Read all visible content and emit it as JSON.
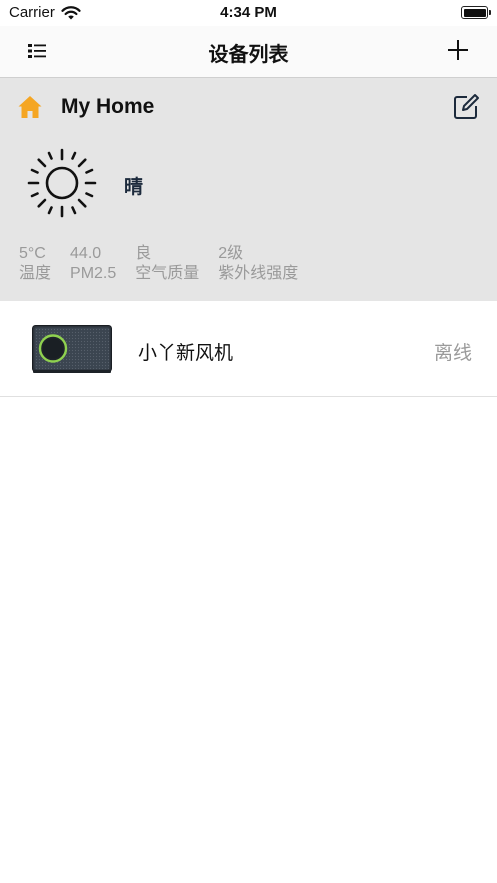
{
  "status_bar": {
    "carrier": "Carrier",
    "time": "4:34 PM"
  },
  "nav": {
    "title": "设备列表",
    "menu_icon": "list-icon",
    "add_icon": "plus-icon"
  },
  "home": {
    "name": "My Home",
    "icon": "home-icon",
    "accent_color": "#f5a623",
    "edit_icon": "edit-icon"
  },
  "weather": {
    "icon": "sun-icon",
    "description": "晴",
    "stats": [
      {
        "value": "5°C",
        "label": "温度"
      },
      {
        "value": "44.0",
        "label": "PM2.5"
      },
      {
        "value": "良",
        "label": "空气质量"
      },
      {
        "value": "2级",
        "label": "紫外线强度"
      }
    ]
  },
  "devices": [
    {
      "name": "小丫新风机",
      "status": "离线",
      "thumb_icon": "air-purifier-icon"
    }
  ]
}
